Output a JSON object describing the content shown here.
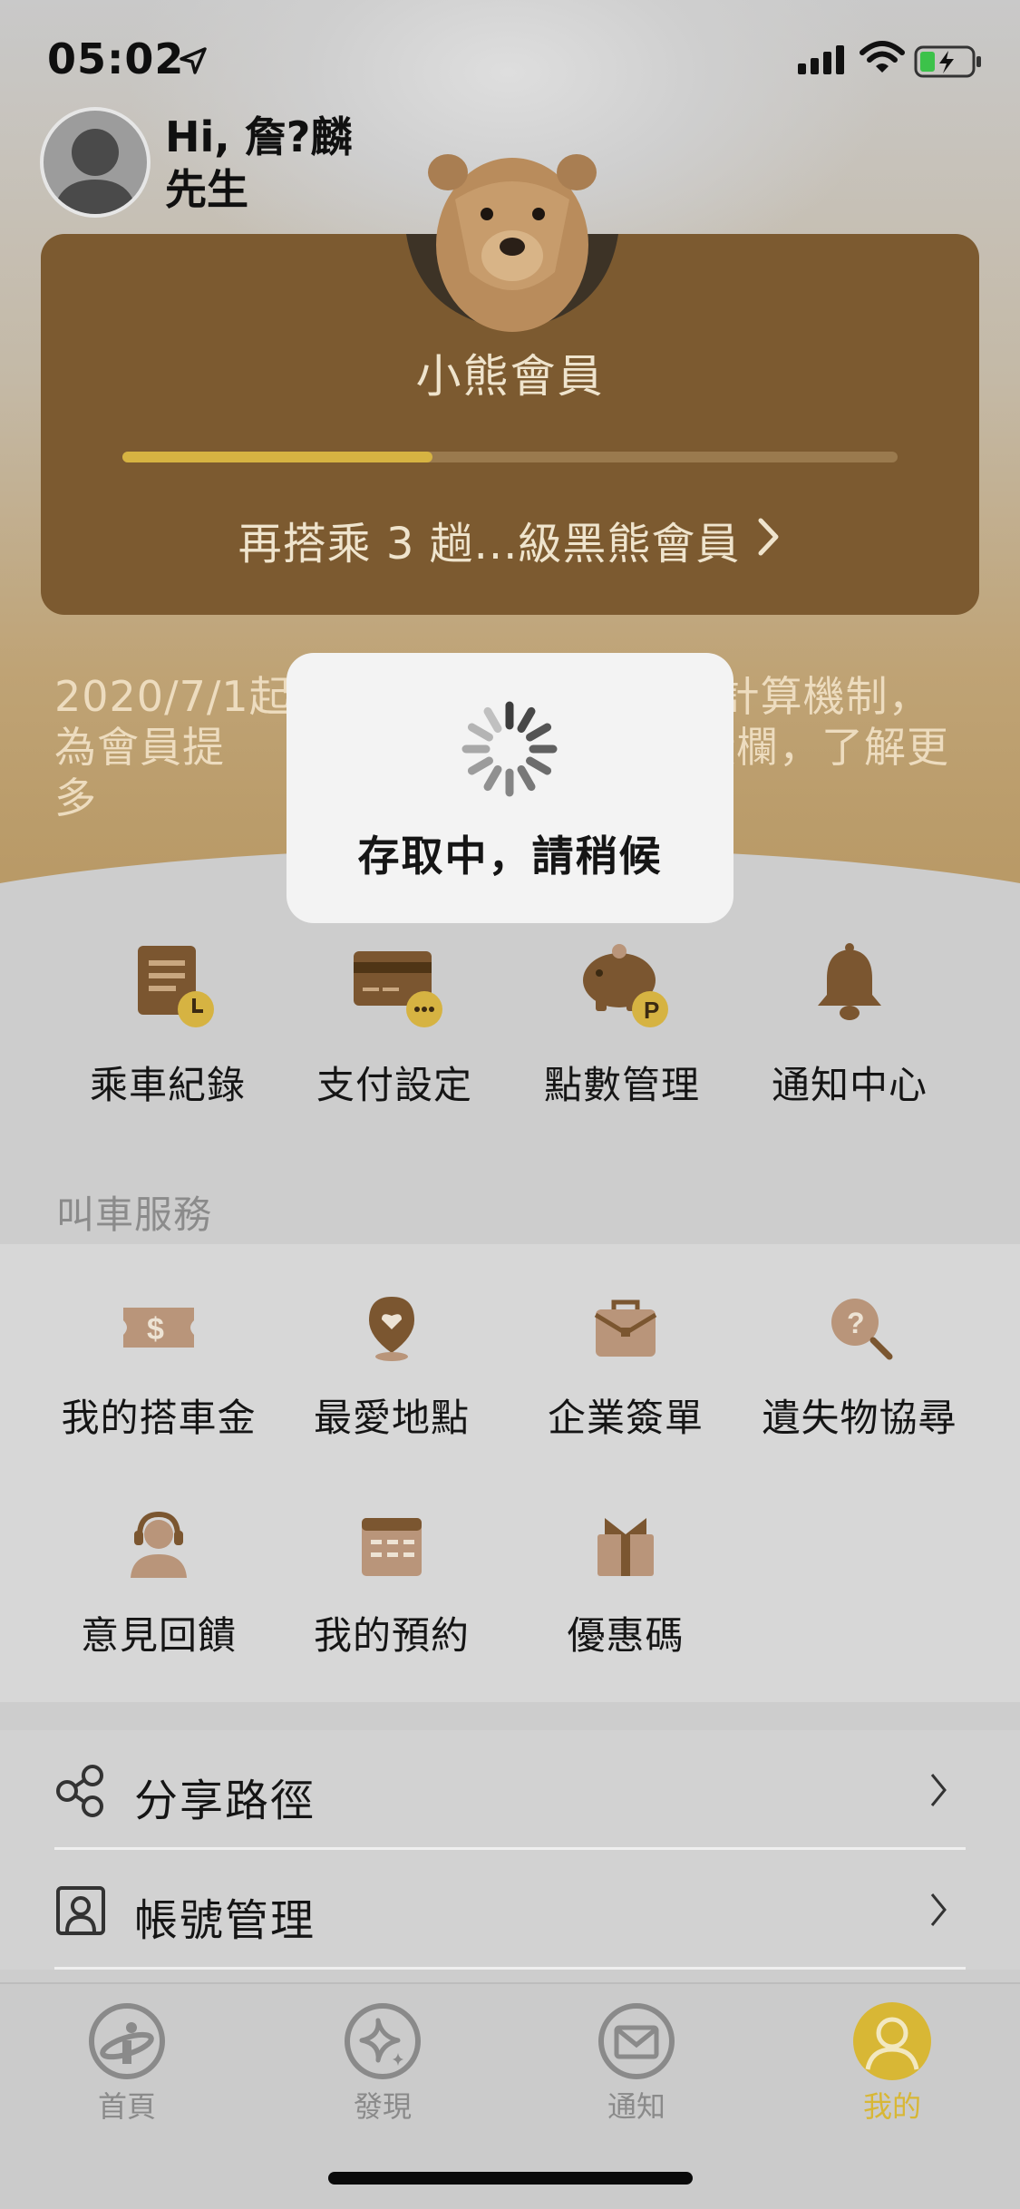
{
  "status_bar": {
    "time": "05:02"
  },
  "user": {
    "greeting": "Hi, 詹?麟 先生"
  },
  "membership": {
    "level": "小熊會員",
    "progress": 0.4,
    "next_level_text": "再搭乘 3 趟...級黑熊會員",
    "notice_text": "2020/7/1起　　　　　　　　會籍計算機制，為會員提　　　　　　　點擊上方橫欄，了解更多"
  },
  "colors": {
    "card": "#7c5a30",
    "progress": "#d6b342",
    "active_tab": "#d8b735",
    "icon_brown": "#7b5630",
    "icon_light": "#b9957a"
  },
  "quick_actions": [
    {
      "label": "乘車紀錄",
      "icon": "ride-record-icon"
    },
    {
      "label": "支付設定",
      "icon": "payment-card-icon"
    },
    {
      "label": "點數管理",
      "icon": "piggy-bank-icon"
    },
    {
      "label": "通知中心",
      "icon": "bell-icon"
    }
  ],
  "call_service": {
    "title": "叫車服務",
    "items": [
      {
        "label": "我的搭車金",
        "icon": "ticket-icon"
      },
      {
        "label": "最愛地點",
        "icon": "favorite-location-icon"
      },
      {
        "label": "企業簽單",
        "icon": "briefcase-icon"
      },
      {
        "label": "遺失物協尋",
        "icon": "lost-search-icon"
      },
      {
        "label": "意見回饋",
        "icon": "headset-icon"
      },
      {
        "label": "我的預約",
        "icon": "calendar-icon"
      },
      {
        "label": "優惠碼",
        "icon": "gift-icon"
      }
    ]
  },
  "list_items": [
    {
      "label": "分享路徑",
      "icon": "share-icon"
    },
    {
      "label": "帳號管理",
      "icon": "account-icon"
    }
  ],
  "tabs": [
    {
      "label": "首頁",
      "icon": "home-logo-icon",
      "active": false
    },
    {
      "label": "發現",
      "icon": "discover-icon",
      "active": false
    },
    {
      "label": "通知",
      "icon": "mail-icon",
      "active": false
    },
    {
      "label": "我的",
      "icon": "profile-icon",
      "active": true
    }
  ],
  "loading": {
    "text": "存取中，請稍候"
  }
}
